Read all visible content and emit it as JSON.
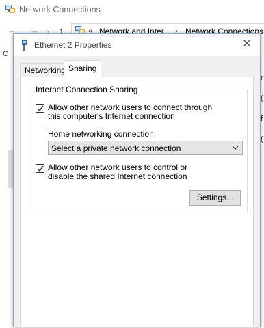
{
  "explorer": {
    "title": "Network Connections",
    "nav": {
      "back": "←",
      "forward": "→",
      "dropdown": "∨",
      "up": "↑"
    },
    "address": {
      "chevron": "«",
      "segments": [
        "Network and Inter...",
        "Network Connections"
      ],
      "separator": "›"
    },
    "left_fragment": "C",
    "right_fragments": [
      "r",
      "(",
      "f",
      "("
    ]
  },
  "dialog": {
    "title": "Ethernet 2 Properties",
    "close_glyph": "✕",
    "tabs": [
      {
        "label": "Networking",
        "selected": false
      },
      {
        "label": "Sharing",
        "selected": true
      }
    ],
    "group_title": "Internet Connection Sharing",
    "allow_connect": {
      "label": "Allow other network users to connect through this computer's Internet connection",
      "checked": true
    },
    "home_networking_label": "Home networking connection:",
    "home_networking_select": {
      "value": "Select a private network connection"
    },
    "allow_control": {
      "label": "Allow other network users to control or disable the shared Internet connection",
      "checked": true
    },
    "settings_button": "Settings..."
  },
  "icons": {
    "network_folder": "network-connections-icon",
    "ethernet": "ethernet-icon",
    "check": "checkmark-icon",
    "chevron_down": "chevron-down-icon",
    "close": "close-icon"
  },
  "colors": {
    "dialog_bg": "#f0f0f0",
    "panel_bg": "#ffffff",
    "dialog_border": "#8aa5c6",
    "button_bg": "#e1e1e1"
  }
}
